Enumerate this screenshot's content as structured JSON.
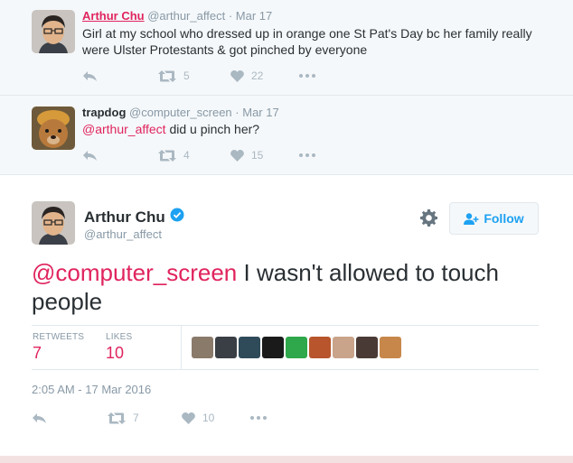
{
  "tweets": [
    {
      "name": "Arthur Chu",
      "handle": "@arthur_affect",
      "sep": "·",
      "date": "Mar 17",
      "text": "Girl at my school who dressed up in orange one St Pat's Day bc her family really were Ulster Protestants & got pinched by everyone",
      "retweets": "5",
      "likes": "22"
    },
    {
      "name": "trapdog",
      "handle": "@computer_screen",
      "sep": "·",
      "date": "Mar 17",
      "mention": "@arthur_affect",
      "text": " did u pinch her?",
      "retweets": "4",
      "likes": "15"
    }
  ],
  "main": {
    "name": "Arthur Chu",
    "handle": "@arthur_affect",
    "follow_label": "Follow",
    "mention": "@computer_screen",
    "text": " I wasn't allowed to touch people",
    "retweets_label": "RETWEETS",
    "retweets": "7",
    "likes_label": "LIKES",
    "likes": "10",
    "timestamp": "2:05 AM - 17 Mar 2016",
    "footer_retweets": "7",
    "footer_likes": "10"
  },
  "likers": [
    "#8a7a6a",
    "#3a3f45",
    "#2f4b5a",
    "#1a1a1a",
    "#2ea84a",
    "#b8552c",
    "#c9a48a",
    "#4a3a35",
    "#c7874a"
  ],
  "colors": {
    "mention": "#e0245e",
    "accent": "#1da1f2",
    "muted": "#8899a6"
  }
}
